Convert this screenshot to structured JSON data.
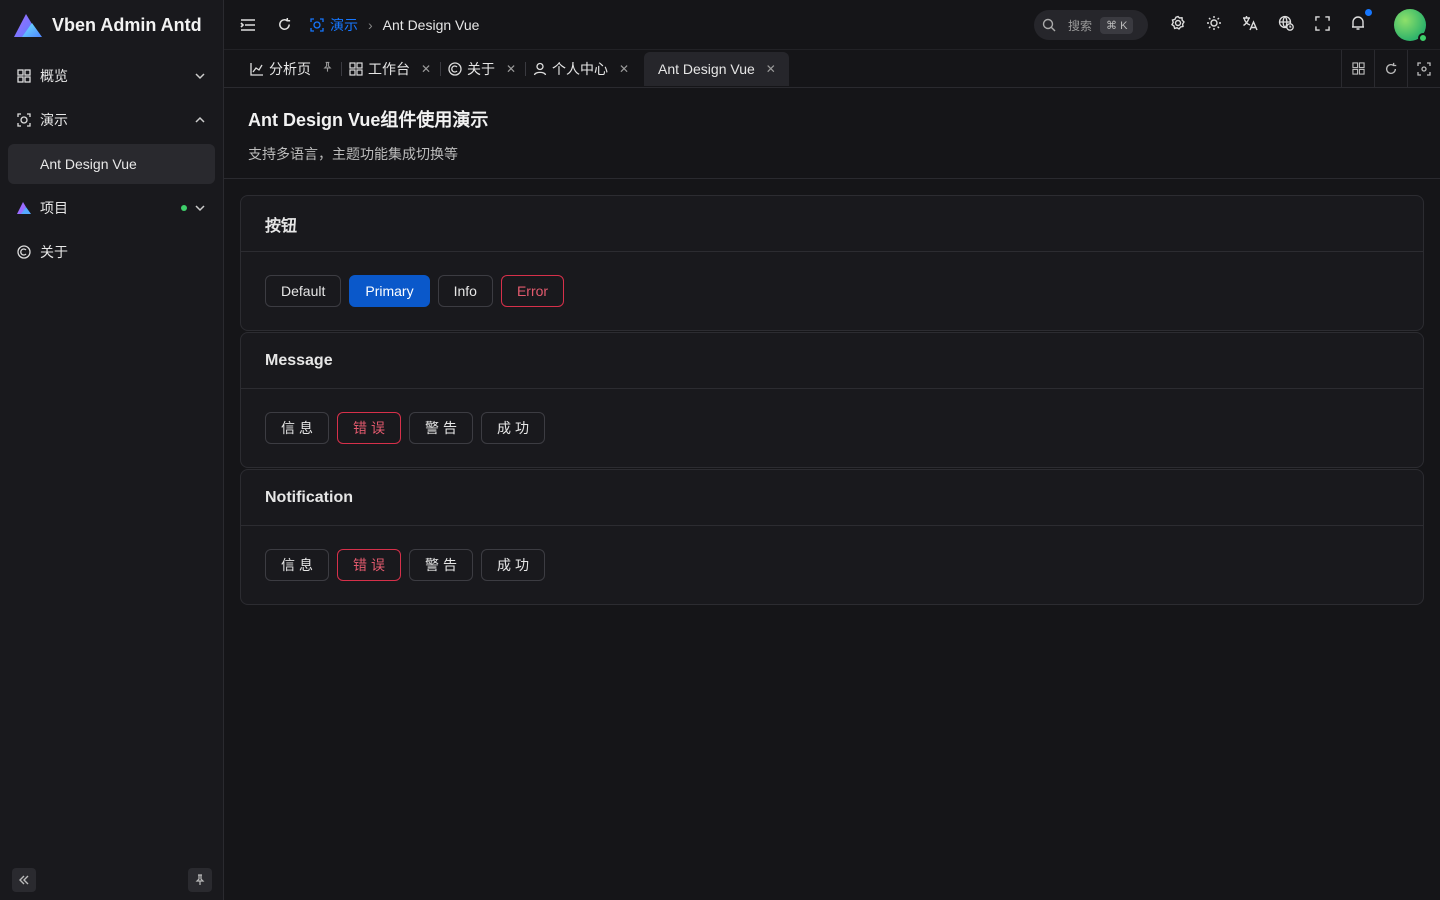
{
  "app": {
    "title": "Vben Admin Antd",
    "watermark": "Vben Admin Antd"
  },
  "sidebar": {
    "items": [
      {
        "label": "概览",
        "icon": "dashboard-icon",
        "expanded": false
      },
      {
        "label": "演示",
        "icon": "demo-icon",
        "expanded": true
      },
      {
        "label": "Ant Design Vue",
        "icon": "",
        "active": true
      },
      {
        "label": "项目",
        "icon": "vben-logo-icon",
        "expanded": false,
        "badge": "dot"
      },
      {
        "label": "关于",
        "icon": "copyright-icon"
      }
    ]
  },
  "header": {
    "breadcrumb": [
      "演示",
      "Ant Design Vue"
    ],
    "search": {
      "placeholder": "搜索",
      "shortcut": "⌘ K"
    },
    "icons": [
      "settings-icon",
      "theme-sun-icon",
      "translate-icon",
      "timezone-icon",
      "fullscreen-icon",
      "bell-icon"
    ]
  },
  "tabs": [
    {
      "label": "分析页",
      "icon": "chart-icon",
      "closable": false,
      "pinned": true
    },
    {
      "label": "工作台",
      "icon": "workspace-icon",
      "closable": true
    },
    {
      "label": "关于",
      "icon": "copyright-icon",
      "closable": true
    },
    {
      "label": "个人中心",
      "icon": "user-icon",
      "closable": true
    },
    {
      "label": "Ant Design Vue",
      "icon": "",
      "closable": true,
      "active": true
    }
  ],
  "page": {
    "title": "Ant Design Vue组件使用演示",
    "description": "支持多语言，主题功能集成切换等"
  },
  "cards": [
    {
      "title": "按钮",
      "buttons": [
        {
          "label": "Default",
          "variant": "default"
        },
        {
          "label": "Primary",
          "variant": "primary"
        },
        {
          "label": "Info",
          "variant": "default"
        },
        {
          "label": "Error",
          "variant": "danger"
        }
      ]
    },
    {
      "title": "Message",
      "buttons": [
        {
          "label": "信息",
          "variant": "default"
        },
        {
          "label": "错误",
          "variant": "danger"
        },
        {
          "label": "警告",
          "variant": "default"
        },
        {
          "label": "成功",
          "variant": "default"
        }
      ]
    },
    {
      "title": "Notification",
      "buttons": [
        {
          "label": "信息",
          "variant": "default"
        },
        {
          "label": "错误",
          "variant": "danger"
        },
        {
          "label": "警告",
          "variant": "default"
        },
        {
          "label": "成功",
          "variant": "default"
        }
      ]
    }
  ],
  "colors": {
    "primary": "#0a58ca",
    "danger": "#d6304a",
    "accent": "#1677ff",
    "background": "#151518",
    "success": "#3ecf6a"
  }
}
